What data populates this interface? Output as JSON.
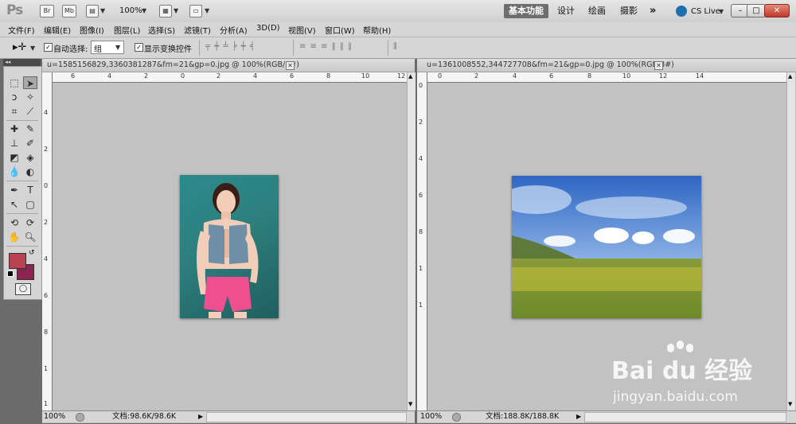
{
  "app": {
    "logo": "Ps",
    "bridge_label": "Br",
    "minibridge_label": "Mb",
    "zoom_value": "100%",
    "workspaces": [
      "基本功能",
      "设计",
      "绘画",
      "摄影"
    ],
    "more_label": "»",
    "cs_live_label": "CS Live",
    "window_buttons": [
      "–",
      "□",
      "✕"
    ]
  },
  "menus": [
    "文件(F)",
    "编辑(E)",
    "图像(I)",
    "图层(L)",
    "选择(S)",
    "滤镜(T)",
    "分析(A)",
    "3D(D)",
    "视图(V)",
    "窗口(W)",
    "帮助(H)"
  ],
  "options": {
    "auto_select_label": "自动选择:",
    "auto_select_checked": "✓",
    "auto_select_value": "组",
    "show_transform_label": "显示变换控件",
    "show_transform_checked": "✓"
  },
  "documents": [
    {
      "title": "u=1585156829,3360381287&fm=21&gp=0.jpg @ 100%(RGB/8#)",
      "close": "✕",
      "ruler_h": [
        "6",
        "4",
        "2",
        "0",
        "2",
        "4",
        "6",
        "8",
        "10",
        "12"
      ],
      "ruler_v": [
        "4",
        "2",
        "0",
        "2",
        "4",
        "6",
        "8",
        "1",
        "1"
      ],
      "zoom": "100%",
      "status": "文档:98.6K/98.6K"
    },
    {
      "title": "u=1361008552,344727708&fm=21&gp=0.jpg @ 100%(RGB/8#)",
      "close": "✕",
      "ruler_h": [
        "0",
        "2",
        "4",
        "6",
        "8",
        "10",
        "12",
        "14"
      ],
      "ruler_v": [
        "0",
        "2",
        "4",
        "6",
        "8",
        "1",
        "1"
      ],
      "zoom": "100%",
      "status": "文档:188.8K/188.8K"
    }
  ],
  "colors": {
    "foreground": "#b8424f",
    "background": "#8c2350"
  },
  "watermark": {
    "logo": "Bai du 经验",
    "url": "jingyan.baidu.com"
  }
}
